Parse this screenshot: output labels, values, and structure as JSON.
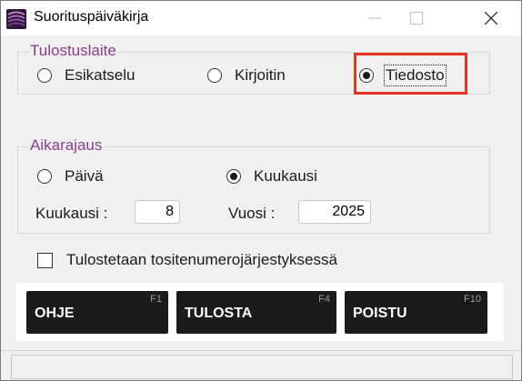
{
  "window": {
    "title": "Suorituspäiväkirja"
  },
  "output_device": {
    "legend": "Tulostuslaite",
    "options": [
      {
        "label": "Esikatselu",
        "selected": false
      },
      {
        "label": "Kirjoitin",
        "selected": false
      },
      {
        "label": "Tiedosto",
        "selected": true
      }
    ]
  },
  "time_range": {
    "legend": "Aikarajaus",
    "options": [
      {
        "label": "Päivä",
        "selected": false
      },
      {
        "label": "Kuukausi",
        "selected": true
      }
    ],
    "month_label": "Kuukausi :",
    "month_value": "8",
    "year_label": "Vuosi :",
    "year_value": "2025"
  },
  "sort_checkbox": {
    "label": "Tulostetaan tositenumerojärjestyksessä",
    "checked": false
  },
  "buttons": [
    {
      "label": "OHJE",
      "key": "F1"
    },
    {
      "label": "TULOSTA",
      "key": "F4"
    },
    {
      "label": "POISTU",
      "key": "F10"
    }
  ],
  "colors": {
    "legend_text": "#8a3d8e",
    "highlight": "#e63320",
    "button_bg": "#1b1b1b"
  },
  "icons": {
    "app": "striped-logo-icon",
    "minimize": "minimize-icon",
    "maximize": "maximize-icon",
    "close": "close-icon"
  }
}
